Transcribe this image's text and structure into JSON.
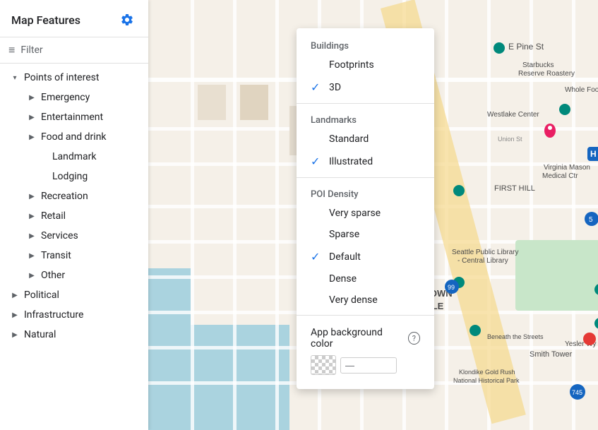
{
  "sidebar": {
    "title": "Map Features",
    "filter_placeholder": "Filter",
    "items": [
      {
        "label": "Points of interest",
        "level": 0,
        "has_arrow": true,
        "expanded": true
      },
      {
        "label": "Emergency",
        "level": 1,
        "has_arrow": true
      },
      {
        "label": "Entertainment",
        "level": 1,
        "has_arrow": true
      },
      {
        "label": "Food and drink",
        "level": 1,
        "has_arrow": true
      },
      {
        "label": "Landmark",
        "level": 2,
        "has_arrow": false
      },
      {
        "label": "Lodging",
        "level": 2,
        "has_arrow": false
      },
      {
        "label": "Recreation",
        "level": 1,
        "has_arrow": true
      },
      {
        "label": "Retail",
        "level": 1,
        "has_arrow": true
      },
      {
        "label": "Services",
        "level": 1,
        "has_arrow": true
      },
      {
        "label": "Transit",
        "level": 1,
        "has_arrow": true
      },
      {
        "label": "Other",
        "level": 1,
        "has_arrow": true
      },
      {
        "label": "Political",
        "level": 0,
        "has_arrow": true
      },
      {
        "label": "Infrastructure",
        "level": 0,
        "has_arrow": true
      },
      {
        "label": "Natural",
        "level": 0,
        "has_arrow": true
      }
    ]
  },
  "dropdown": {
    "buildings_label": "Buildings",
    "footprints_label": "Footprints",
    "three_d_label": "3D",
    "three_d_checked": true,
    "landmarks_label": "Landmarks",
    "standard_label": "Standard",
    "illustrated_label": "Illustrated",
    "illustrated_checked": true,
    "poi_density_label": "POI Density",
    "density_options": [
      {
        "label": "Very sparse",
        "checked": false
      },
      {
        "label": "Sparse",
        "checked": false
      },
      {
        "label": "Default",
        "checked": true
      },
      {
        "label": "Dense",
        "checked": false
      },
      {
        "label": "Very dense",
        "checked": false
      }
    ],
    "bg_color_label": "App background color",
    "help_icon": "?",
    "color_value": "—"
  },
  "icons": {
    "gear": "⚙",
    "filter_lines": "≡",
    "arrow_right": "▶",
    "arrow_down": "▾",
    "checkmark": "✓"
  }
}
